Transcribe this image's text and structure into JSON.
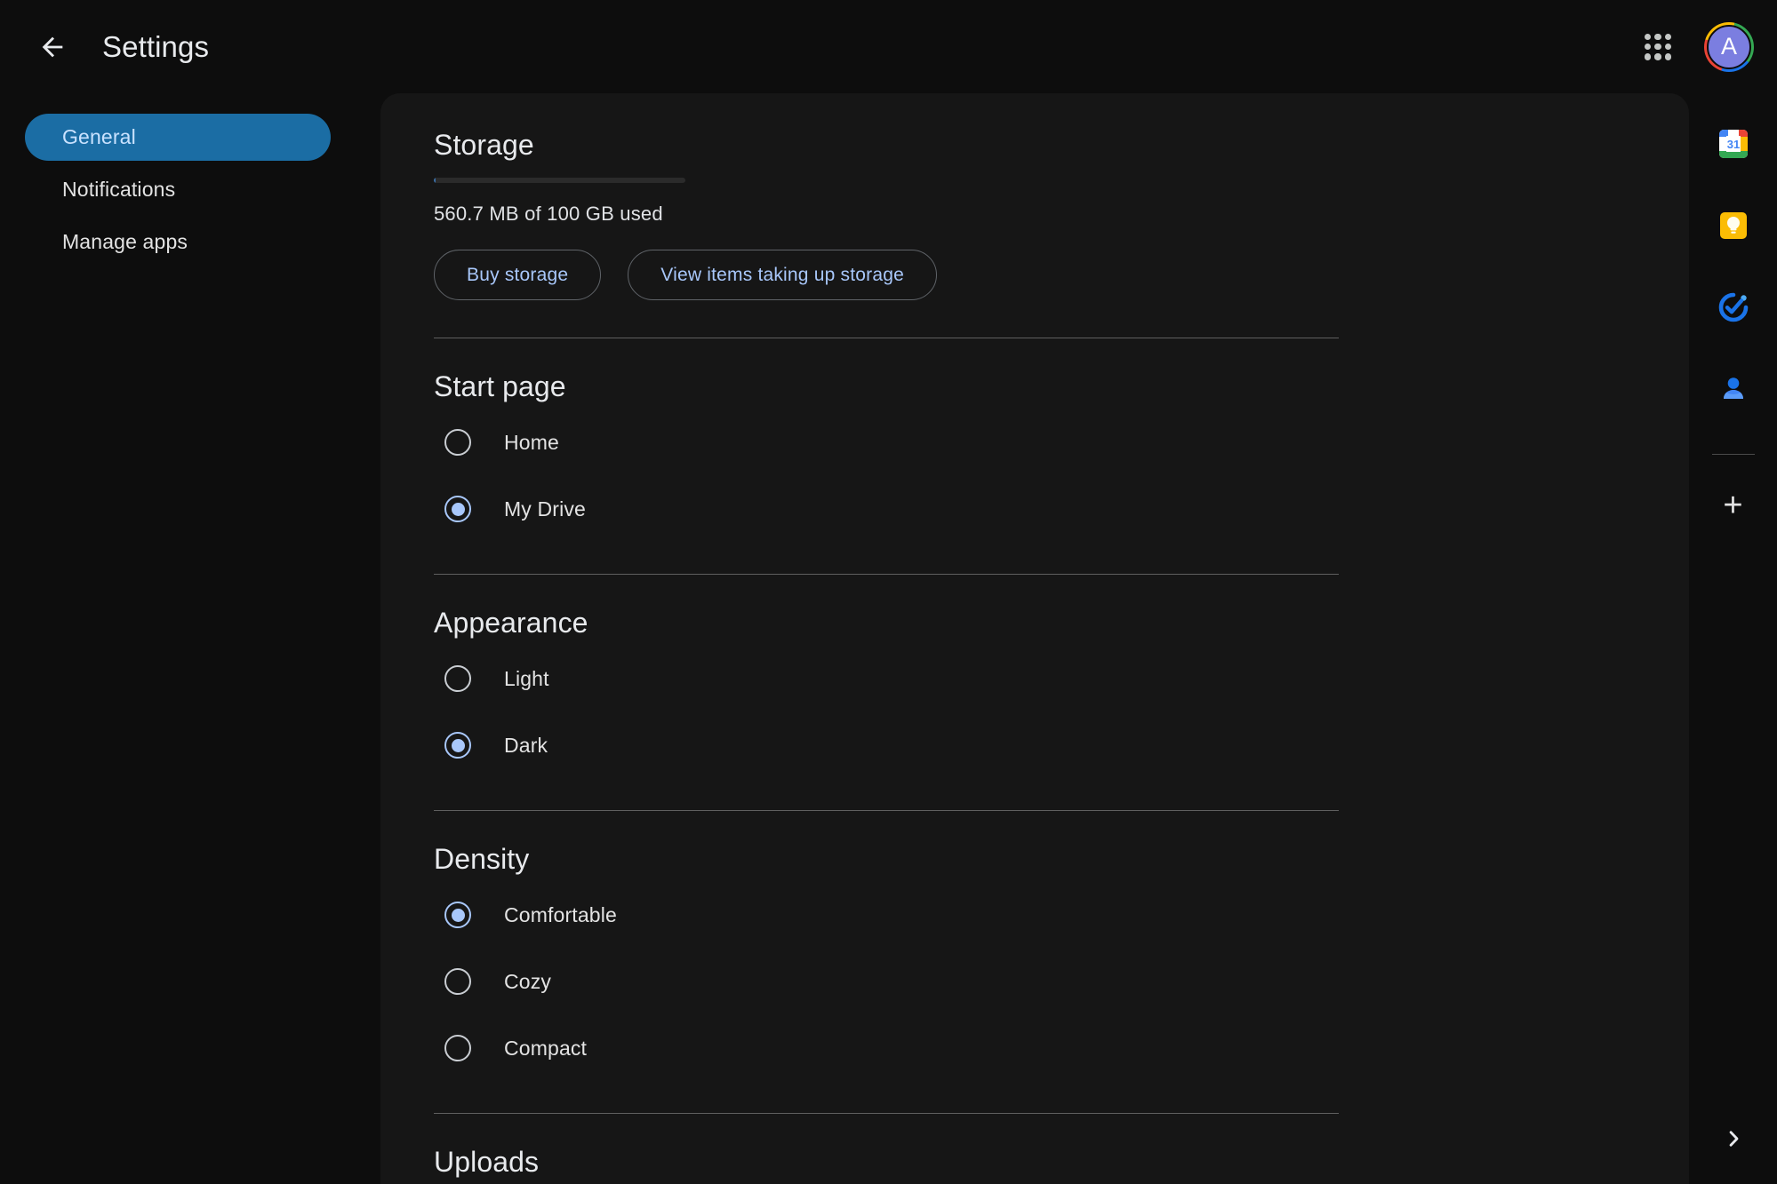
{
  "header": {
    "back_icon": "arrow-left-icon",
    "title": "Settings",
    "apps_icon": "apps-grid-icon",
    "avatar_letter": "A"
  },
  "sidebar": {
    "items": [
      {
        "label": "General",
        "selected": true
      },
      {
        "label": "Notifications",
        "selected": false
      },
      {
        "label": "Manage apps",
        "selected": false
      }
    ]
  },
  "main": {
    "storage": {
      "heading": "Storage",
      "usage_text": "560.7 MB of 100 GB used",
      "used_percent": 0.55,
      "buy_label": "Buy storage",
      "view_label": "View items taking up storage"
    },
    "start_page": {
      "heading": "Start page",
      "options": [
        {
          "label": "Home",
          "selected": false
        },
        {
          "label": "My Drive",
          "selected": true
        }
      ]
    },
    "appearance": {
      "heading": "Appearance",
      "options": [
        {
          "label": "Light",
          "selected": false
        },
        {
          "label": "Dark",
          "selected": true
        }
      ]
    },
    "density": {
      "heading": "Density",
      "options": [
        {
          "label": "Comfortable",
          "selected": true
        },
        {
          "label": "Cozy",
          "selected": false
        },
        {
          "label": "Compact",
          "selected": false
        }
      ]
    },
    "uploads": {
      "heading": "Uploads"
    }
  },
  "right_rail": {
    "items": [
      {
        "icon": "google-calendar-icon",
        "badge": "31"
      },
      {
        "icon": "google-keep-icon"
      },
      {
        "icon": "google-tasks-icon"
      },
      {
        "icon": "google-contacts-icon"
      }
    ],
    "add_icon": "plus-icon",
    "add_label": "+",
    "expand_icon": "chevron-right-icon"
  },
  "colors": {
    "page_bg": "#0d0d0d",
    "card_bg": "#161616",
    "accent_blue": "#a8c7fa",
    "selected_pill": "#1b6da4",
    "selected_pill_text": "#c9e2ff",
    "divider": "#5f5f5f",
    "text_primary": "#e3e3e3"
  }
}
